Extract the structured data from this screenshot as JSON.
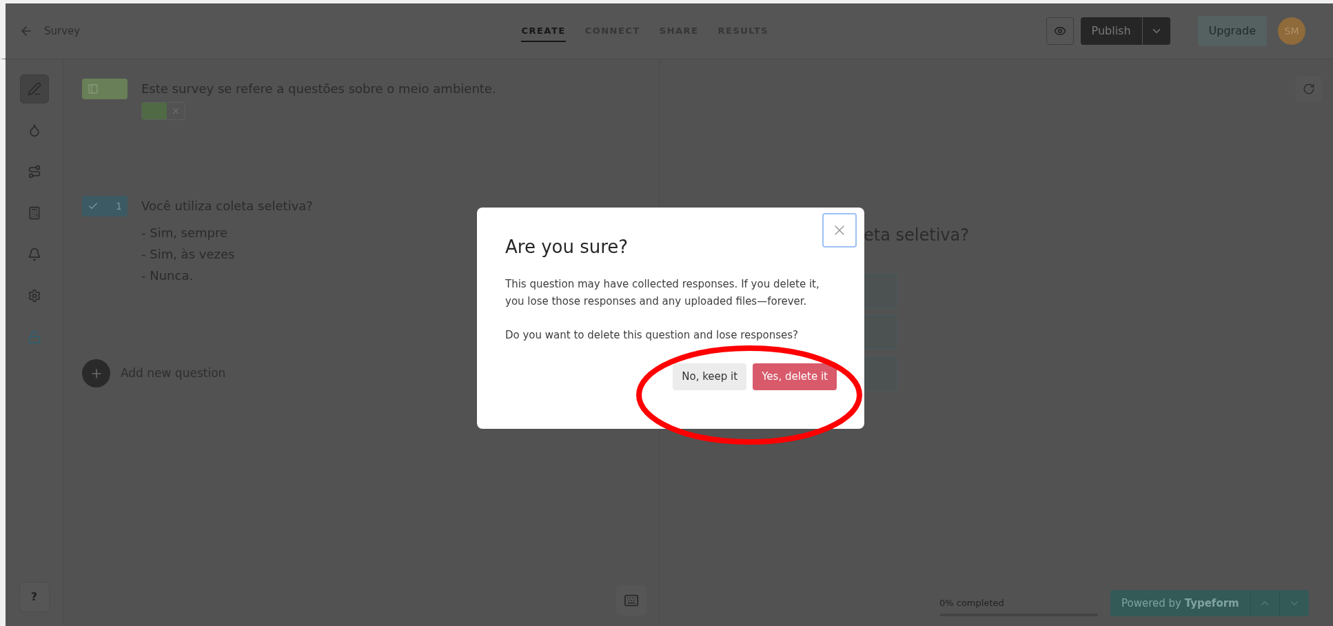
{
  "top_bar": {
    "title": "Survey",
    "tabs": [
      {
        "label": "CREATE",
        "selected": true
      },
      {
        "label": "CONNECT",
        "selected": false
      },
      {
        "label": "SHARE",
        "selected": false
      },
      {
        "label": "RESULTS",
        "selected": false
      }
    ],
    "publish_button": "Publish",
    "upgrade_button": "Upgrade",
    "avatar": "SM"
  },
  "sidebar": {
    "items": [
      {
        "kind": "pen",
        "selected": true
      },
      {
        "kind": "drop",
        "selected": false
      },
      {
        "kind": "route",
        "selected": false
      },
      {
        "kind": "calculator",
        "selected": false
      },
      {
        "kind": "bell",
        "selected": false
      },
      {
        "kind": "gear",
        "selected": false
      },
      {
        "kind": "lock",
        "selected": false
      }
    ],
    "help_button": "?"
  },
  "builder": {
    "blocks": [
      {
        "kind": "statement",
        "text": "Este survey se refere a questões sobre o meio ambiente.",
        "image": true
      },
      {
        "kind": "question",
        "number": "1",
        "text": "Você utiliza coleta seletiva?",
        "choices": [
          "- Sim, sempre",
          "- Sim, às vezes",
          "- Nunca."
        ]
      }
    ],
    "add_question": "Add new question"
  },
  "preview": {
    "question_fragment": "eta seletiva?",
    "choice_boxes": [
      {
        "kind": "choice"
      },
      {
        "kind": "choice"
      },
      {
        "kind": "choice"
      }
    ],
    "progress": {
      "label": "0% completed",
      "level": 0
    },
    "powered_by": "Powered by **Typeform**"
  },
  "dialog": {
    "title": "Are you sure?",
    "paragraphs": [
      "This question may have collected responses. If you delete it, you lose those responses and any uploaded files—forever.",
      "Do you want to delete this question and lose responses?"
    ],
    "buttons": [
      {
        "label": "No, keep it",
        "kind": "secondary"
      },
      {
        "label": "Yes, delete it",
        "kind": "danger"
      }
    ]
  }
}
